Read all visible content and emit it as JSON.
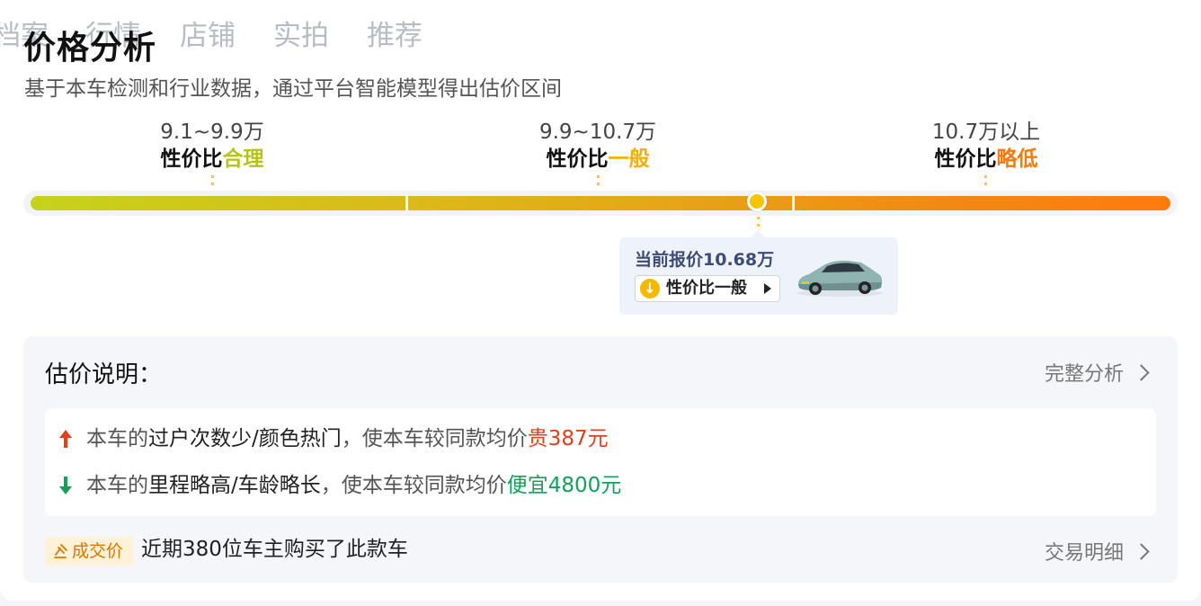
{
  "nav_tabs": [
    "档案",
    "行情",
    "店铺",
    "实拍",
    "推荐"
  ],
  "title": "价格分析",
  "subtitle": "基于本车检测和行业数据，通过平台智能模型得出估价区间",
  "ranges": [
    {
      "price": "9.1~9.9万",
      "cp_prefix": "性价比",
      "cp_level": "合理",
      "color": "#b5c41a"
    },
    {
      "price": "9.9~10.7万",
      "cp_prefix": "性价比",
      "cp_level": "一般",
      "color": "#f1b000"
    },
    {
      "price": "10.7万以上",
      "cp_prefix": "性价比",
      "cp_level": "略低",
      "color": "#f57b0d"
    }
  ],
  "current": {
    "price_label": "当前报价10.68万",
    "cp_button": "性价比一般",
    "car_icon": "car-thumbnail"
  },
  "explain": {
    "title": "估价说明：",
    "full_analysis_link": "完整分析",
    "reasons": [
      {
        "direction": "up",
        "prefix": "本车的",
        "factor": "过户次数少/颜色热门",
        "middle": "，使本车较同款均价",
        "amount": "贵387元",
        "color": "#e0401c"
      },
      {
        "direction": "down",
        "prefix": "本车的",
        "factor": "里程略高/车龄略长",
        "middle": "，使本车较同款均价",
        "amount": "便宜4800元",
        "color": "#14a05a"
      }
    ],
    "deal_badge": "成交价",
    "deal_text": "近期380位车主购买了此款车",
    "deal_link": "交易明细"
  },
  "colors": {
    "bar_start": "#c5d31c",
    "bar_end": "#ff7a0d",
    "marker": "#f7c400",
    "up_arrow": "#e0401c",
    "down_arrow": "#14a05a"
  }
}
